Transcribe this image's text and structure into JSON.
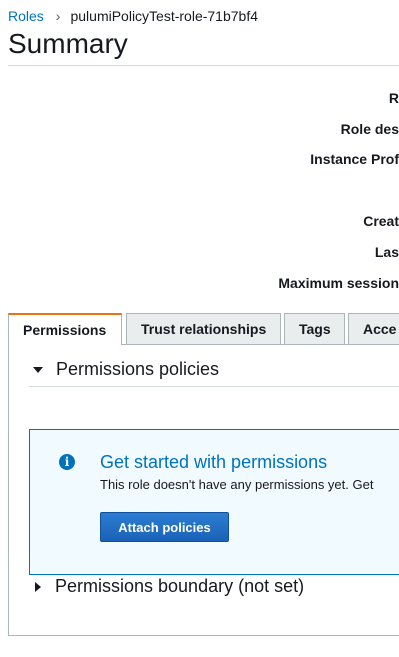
{
  "breadcrumb": {
    "parent": "Roles",
    "separator": "›",
    "current": "pulumiPolicyTest-role-71b7bf4"
  },
  "page": {
    "title": "Summary"
  },
  "summary": {
    "labels": [
      "R",
      "Role des",
      "Instance Prof",
      "Creat",
      "Las",
      "Maximum session"
    ]
  },
  "tabs": [
    {
      "label": "Permissions",
      "active": true
    },
    {
      "label": "Trust relationships",
      "active": false
    },
    {
      "label": "Tags",
      "active": false
    },
    {
      "label": "Acce",
      "active": false
    }
  ],
  "permissions": {
    "policies_heading": "Permissions policies",
    "info_title": "Get started with permissions",
    "info_text": "This role doesn't have any permissions yet. Get",
    "attach_button": "Attach policies",
    "boundary_heading": "Permissions boundary (not set)"
  },
  "colors": {
    "link": "#0073bb",
    "active_tab_accent": "#ec7211",
    "primary_button": "#1f6ec4",
    "info_background": "#f1faff"
  }
}
